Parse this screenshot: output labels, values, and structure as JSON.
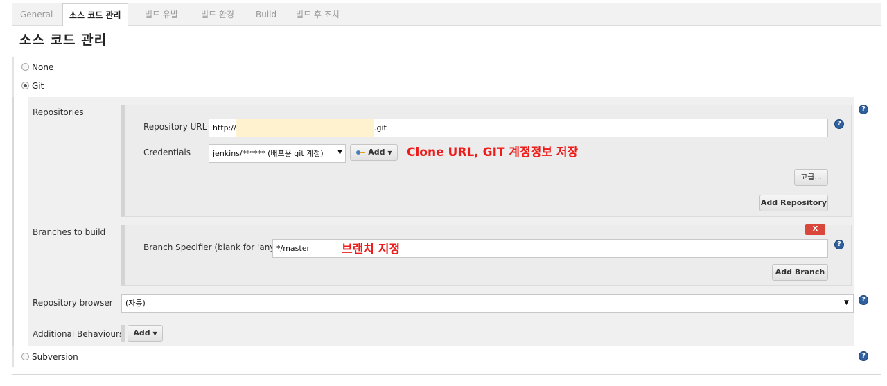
{
  "tabs": [
    {
      "label": "General",
      "active": false
    },
    {
      "label": "소스 코드 관리",
      "active": true
    },
    {
      "label": "빌드 유발",
      "active": false
    },
    {
      "label": "빌드 환경",
      "active": false
    },
    {
      "label": "Build",
      "active": false
    },
    {
      "label": "빌드 후 조치",
      "active": false
    }
  ],
  "section": {
    "title": "소스 코드 관리"
  },
  "scm_options": {
    "none": "None",
    "git": "Git",
    "subversion": "Subversion",
    "selected": "Git"
  },
  "repositories": {
    "label": "Repositories",
    "url_label": "Repository URL",
    "url_prefix": "http://",
    "url_suffix": ".git",
    "credentials_label": "Credentials",
    "credentials_value": "jenkins/****** (배포용 git 계정)",
    "add_label": "Add",
    "advanced_label": "고급...",
    "add_repository_label": "Add Repository"
  },
  "branches": {
    "label": "Branches to build",
    "delete_label": "X",
    "specifier_label": "Branch Specifier (blank for 'any')",
    "specifier_value": "*/master",
    "add_branch_label": "Add Branch"
  },
  "repo_browser": {
    "label": "Repository browser",
    "value": "(자동)"
  },
  "additional_behaviours": {
    "label": "Additional Behaviours",
    "add_label": "Add"
  },
  "annotations": {
    "clone": "Clone URL, GIT 계정정보 저장",
    "branch": "브랜치 지정",
    "color": "#ee1b1b"
  },
  "colors": {
    "help_icon": "#2e5f9e",
    "delete_button": "#d9463c",
    "masked_url": "#fff3cf"
  },
  "icons": [
    "help-icon",
    "key-icon",
    "caret-down-icon",
    "radio-icon"
  ]
}
